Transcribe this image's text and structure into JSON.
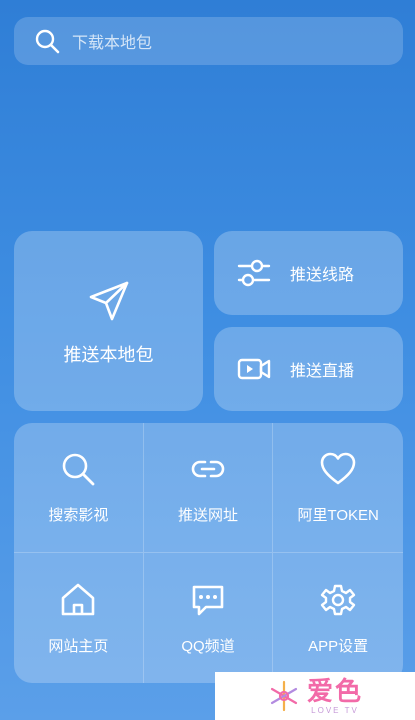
{
  "search": {
    "placeholder": "下载本地包",
    "icon": "search-icon"
  },
  "cards": {
    "push_local": {
      "label": "推送本地包",
      "icon": "send-icon"
    },
    "push_route": {
      "label": "推送线路",
      "icon": "sliders-icon"
    },
    "push_live": {
      "label": "推送直播",
      "icon": "video-camera-icon"
    }
  },
  "grid": {
    "items": [
      {
        "label": "搜索影视",
        "icon": "search-icon"
      },
      {
        "label": "推送网址",
        "icon": "link-icon"
      },
      {
        "label": "阿里TOKEN",
        "icon": "heart-icon"
      },
      {
        "label": "网站主页",
        "icon": "home-icon"
      },
      {
        "label": "QQ频道",
        "icon": "chat-icon"
      },
      {
        "label": "APP设置",
        "icon": "gear-icon"
      }
    ]
  },
  "watermark": {
    "main": "爱色",
    "sub": "LOVE TV"
  },
  "colors": {
    "background_top": "#2f7ed6",
    "background_bottom": "#5b9fe9",
    "watermark_pink": "#f26aa8"
  }
}
